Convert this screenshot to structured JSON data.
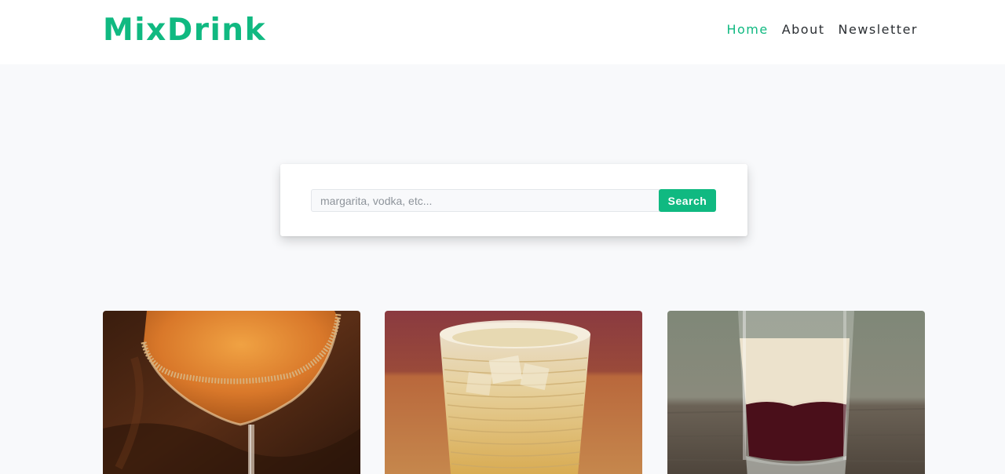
{
  "header": {
    "logo": "MixDrink",
    "nav": [
      {
        "label": "Home",
        "active": true
      },
      {
        "label": "About",
        "active": false
      },
      {
        "label": "Newsletter",
        "active": false
      }
    ]
  },
  "search": {
    "placeholder": "margarita, vodka, etc...",
    "value": "",
    "button_label": "Search"
  },
  "drinks": [
    {
      "image": "orange-cocktail-martini-glass-sugar-rim"
    },
    {
      "image": "golden-drink-ridged-glass-with-ice"
    },
    {
      "image": "layered-shot-cream-over-red"
    }
  ],
  "colors": {
    "accent": "#10b981",
    "background": "#f8f9fb",
    "text": "#2b2f33"
  }
}
